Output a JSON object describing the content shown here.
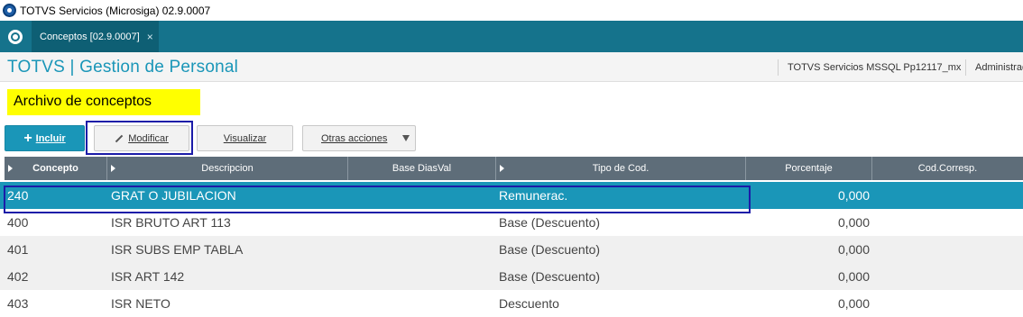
{
  "window": {
    "title": "TOTVS Servicios (Microsiga) 02.9.0007"
  },
  "tabs": [
    {
      "label": "Conceptos [02.9.0007]",
      "close": "×"
    }
  ],
  "header": {
    "brand": "TOTVS | Gestion de Personal",
    "environment": "TOTVS Servicios MSSQL Pp12117_mx",
    "user": "Administrad"
  },
  "annotation": {
    "label": "Archivo de conceptos"
  },
  "toolbar": {
    "incluir_label": "Incluir",
    "modificar_label": "Modificar",
    "visualizar_label": "Visualizar",
    "otras_label": "Otras acciones"
  },
  "grid": {
    "columns": [
      "Concepto",
      "Descripcion",
      "Base DiasVal",
      "Tipo de Cod.",
      "Porcentaje",
      "Cod.Corresp."
    ],
    "rows": [
      {
        "concepto": "240",
        "descripcion": "GRAT O JUBILACION",
        "tipo": "Remunerac.",
        "porcentaje": "0,000"
      },
      {
        "concepto": "400",
        "descripcion": "ISR BRUTO ART 113",
        "tipo": "Base (Descuento)",
        "porcentaje": "0,000"
      },
      {
        "concepto": "401",
        "descripcion": "ISR SUBS EMP TABLA",
        "tipo": "Base (Descuento)",
        "porcentaje": "0,000"
      },
      {
        "concepto": "402",
        "descripcion": "ISR ART 142",
        "tipo": "Base (Descuento)",
        "porcentaje": "0,000"
      },
      {
        "concepto": "403",
        "descripcion": "ISR NETO",
        "tipo": "Descuento",
        "porcentaje": "0,000"
      }
    ]
  },
  "colors": {
    "accent": "#1a96b8",
    "tabbar": "#15738c",
    "grid_header": "#5e6d79",
    "highlight": "#ffff00",
    "selection_box": "#1c1ca8"
  }
}
